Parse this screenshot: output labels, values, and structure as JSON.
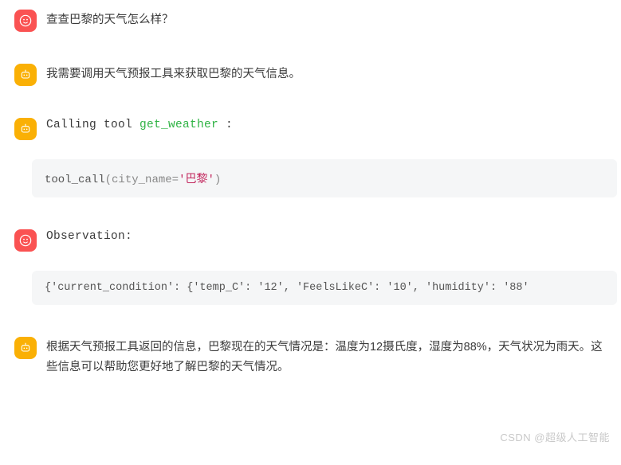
{
  "messages": {
    "user_query": "查查巴黎的天气怎么样？",
    "assistant_think": "我需要调用天气预报工具来获取巴黎的天气信息。",
    "calling_tool_prefix": "Calling tool ",
    "tool_name": "get_weather",
    "tool_suffix": " :",
    "tool_call_func": "tool_call",
    "tool_call_kw": "city_name",
    "tool_call_eq": "=",
    "tool_call_val": "'巴黎'",
    "observation_label": "Observation:",
    "observation_data": "{'current_condition': {'temp_C': '12', 'FeelsLikeC': '10', 'humidity': '88'",
    "final_answer": "根据天气预报工具返回的信息，巴黎现在的天气情况是：温度为12摄氏度，湿度为88%，天气状况为雨天。这些信息可以帮助您更好地了解巴黎的天气情况。"
  },
  "watermark": "CSDN @超级人工智能"
}
